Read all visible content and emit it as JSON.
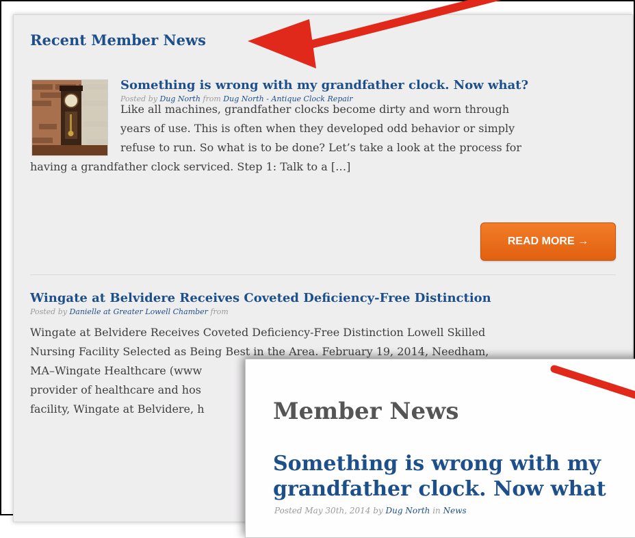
{
  "widget": {
    "title": "Recent Member News",
    "posts": [
      {
        "title": "Something is wrong with my grandfather clock. Now what?",
        "posted_by_label": "Posted by",
        "author": "Dug North",
        "from_label": "from",
        "source": "Dug North - Antique Clock Repair",
        "excerpt_lines": [
          "Like all machines, grandfather clocks become dirty and worn through",
          "years of use. This is often when they developed odd behavior or simply",
          "refuse to run. So what is to be done? Let’s take a look at the process for",
          "having a grandfather clock serviced. Step 1: Talk to a […]"
        ],
        "read_more": "READ MORE →"
      },
      {
        "title": "Wingate at Belvidere Receives Coveted Deficiency-Free Distinction",
        "posted_by_label": "Posted by",
        "author": "Danielle at Greater Lowell Chamber",
        "from_label": "from",
        "excerpt_lines": [
          "Wingate at Belvidere Receives Coveted Deficiency-Free Distinction Lowell Skilled",
          "Nursing Facility Selected as Being Best in the Area. February 19, 2014, Needham,",
          "MA–Wingate Healthcare (www",
          "provider of healthcare and hos",
          "facility, Wingate at Belvidere, h"
        ]
      }
    ]
  },
  "overlay": {
    "heading": "Member News",
    "post_title_lines": [
      "Something is wrong with my",
      "grandfather clock. Now what"
    ],
    "meta_prefix": "Posted May 30th, 2014 by",
    "meta_author": "Dug North",
    "meta_in": "in",
    "meta_category": "News"
  },
  "colors": {
    "link": "#1d4f8a",
    "button": "#e8691a",
    "arrow": "#e0291b",
    "panel_bg": "#efeeef"
  }
}
